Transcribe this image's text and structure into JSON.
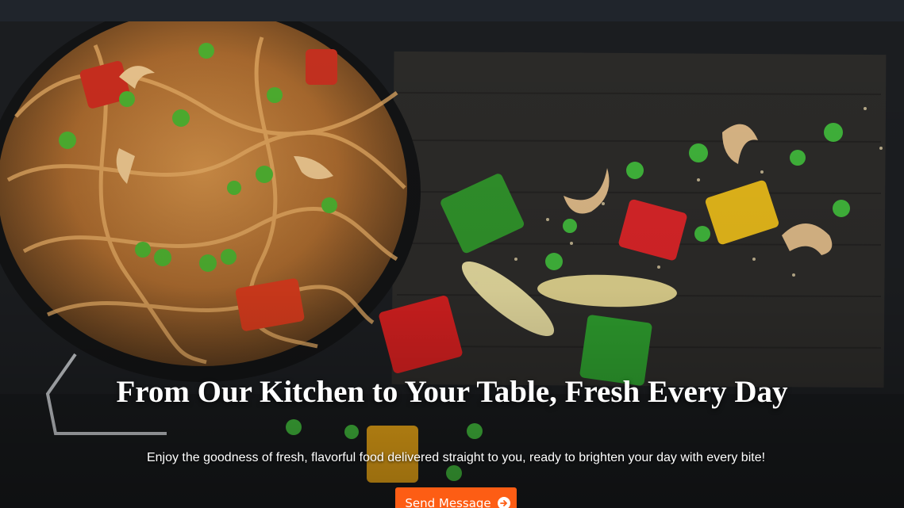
{
  "hero": {
    "headline": "From Our Kitchen to Your Table, Fresh Every Day",
    "subtext": "Enjoy the goodness of fresh, flavorful food delivered straight to you, ready to brighten your day with every bite!",
    "cta_label": "Send Message",
    "cta_icon": "arrow-right-circle-icon",
    "accent_color": "#fd5d14"
  }
}
